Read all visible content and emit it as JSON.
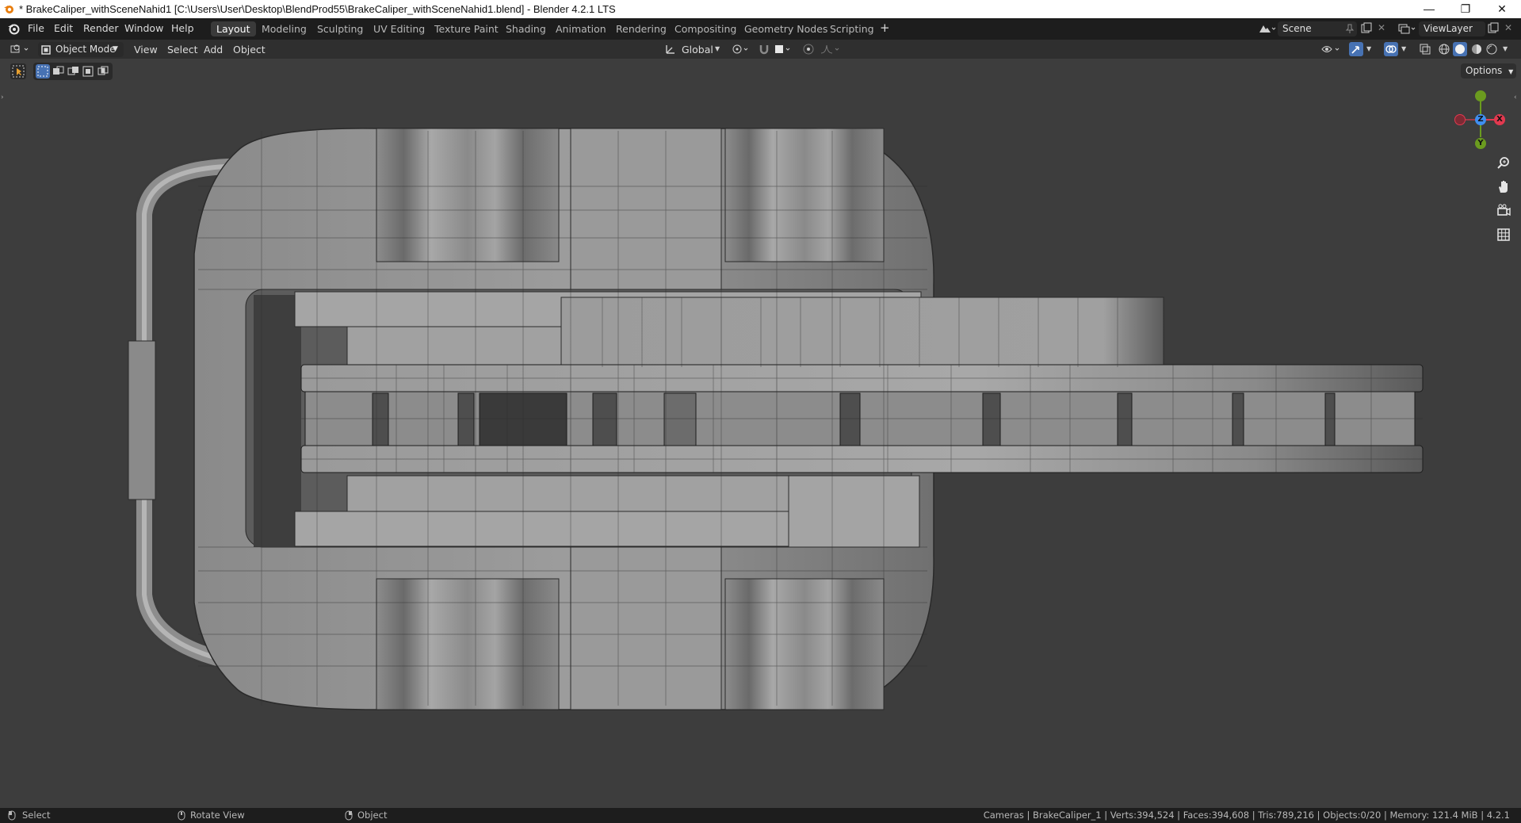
{
  "window": {
    "title": "* BrakeCaliper_withSceneNahid1 [C:\\Users\\User\\Desktop\\BlendProd55\\BrakeCaliper_withSceneNahid1.blend] - Blender 4.2.1 LTS",
    "minimize": "—",
    "maximize": "❐",
    "close": "✕"
  },
  "menu": {
    "items": [
      "File",
      "Edit",
      "Render",
      "Window",
      "Help"
    ]
  },
  "workspaces": {
    "tabs": [
      "Layout",
      "Modeling",
      "Sculpting",
      "UV Editing",
      "Texture Paint",
      "Shading",
      "Animation",
      "Rendering",
      "Compositing",
      "Geometry Nodes",
      "Scripting"
    ],
    "active": "Layout",
    "add": "+"
  },
  "scene": {
    "name": "Scene",
    "view_layer": "ViewLayer"
  },
  "header": {
    "mode": "Object Mode",
    "menus": [
      "View",
      "Select",
      "Add",
      "Object"
    ],
    "orientation": "Global"
  },
  "toolbar": {
    "options": "Options"
  },
  "gizmo": {
    "x": "X",
    "y": "Y",
    "z": "Z"
  },
  "status": {
    "select": "Select",
    "rotate": "Rotate View",
    "object": "Object",
    "stats": "Cameras | BrakeCaliper_1 | Verts:394,524 | Faces:394,608 | Tris:789,216 | Objects:0/20 | Memory: 121.4 MiB | 4.2.1"
  },
  "colors": {
    "accent_blue": "#4772b3",
    "axis_x": "#e2394f",
    "axis_y": "#6b9b1f",
    "axis_z": "#3f8ef0"
  }
}
